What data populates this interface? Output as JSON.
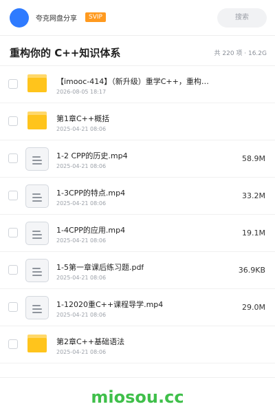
{
  "header": {
    "brand": "夸克网盘分享",
    "badge": "SVIP",
    "search_label": "搜索",
    "accent_color": "#2f7bff"
  },
  "page": {
    "title": "重构你的 C++知识体系",
    "meta": "共 220 项 · 16.2G"
  },
  "files": [
    {
      "icon": "folder-icon",
      "name": "【imooc-414】（新升级）重学C++，重构…",
      "date": "2026-08-05 18:17",
      "size": ""
    },
    {
      "icon": "folder-icon",
      "name": "第1章C++概括",
      "date": "2025-04-21 08:06",
      "size": ""
    },
    {
      "icon": "file-icon",
      "name": "1-2 CPP的历史.mp4",
      "date": "2025-04-21 08:06",
      "size": "58.9M"
    },
    {
      "icon": "file-icon",
      "name": "1-3CPP的特点.mp4",
      "date": "2025-04-21 08:06",
      "size": "33.2M"
    },
    {
      "icon": "file-icon",
      "name": "1-4CPP的应用.mp4",
      "date": "2025-04-21 08:06",
      "size": "19.1M"
    },
    {
      "icon": "file-icon",
      "name": "1-5第一章课后练习题.pdf",
      "date": "2025-04-21 08:06",
      "size": "36.9KB"
    },
    {
      "icon": "file-icon",
      "name": "1-12020重C++课程导学.mp4",
      "date": "2025-04-21 08:06",
      "size": "29.0M"
    },
    {
      "icon": "folder-icon",
      "name": "第2章C++基础语法",
      "date": "2025-04-21 08:06",
      "size": ""
    }
  ],
  "watermark": "miosou.cc"
}
